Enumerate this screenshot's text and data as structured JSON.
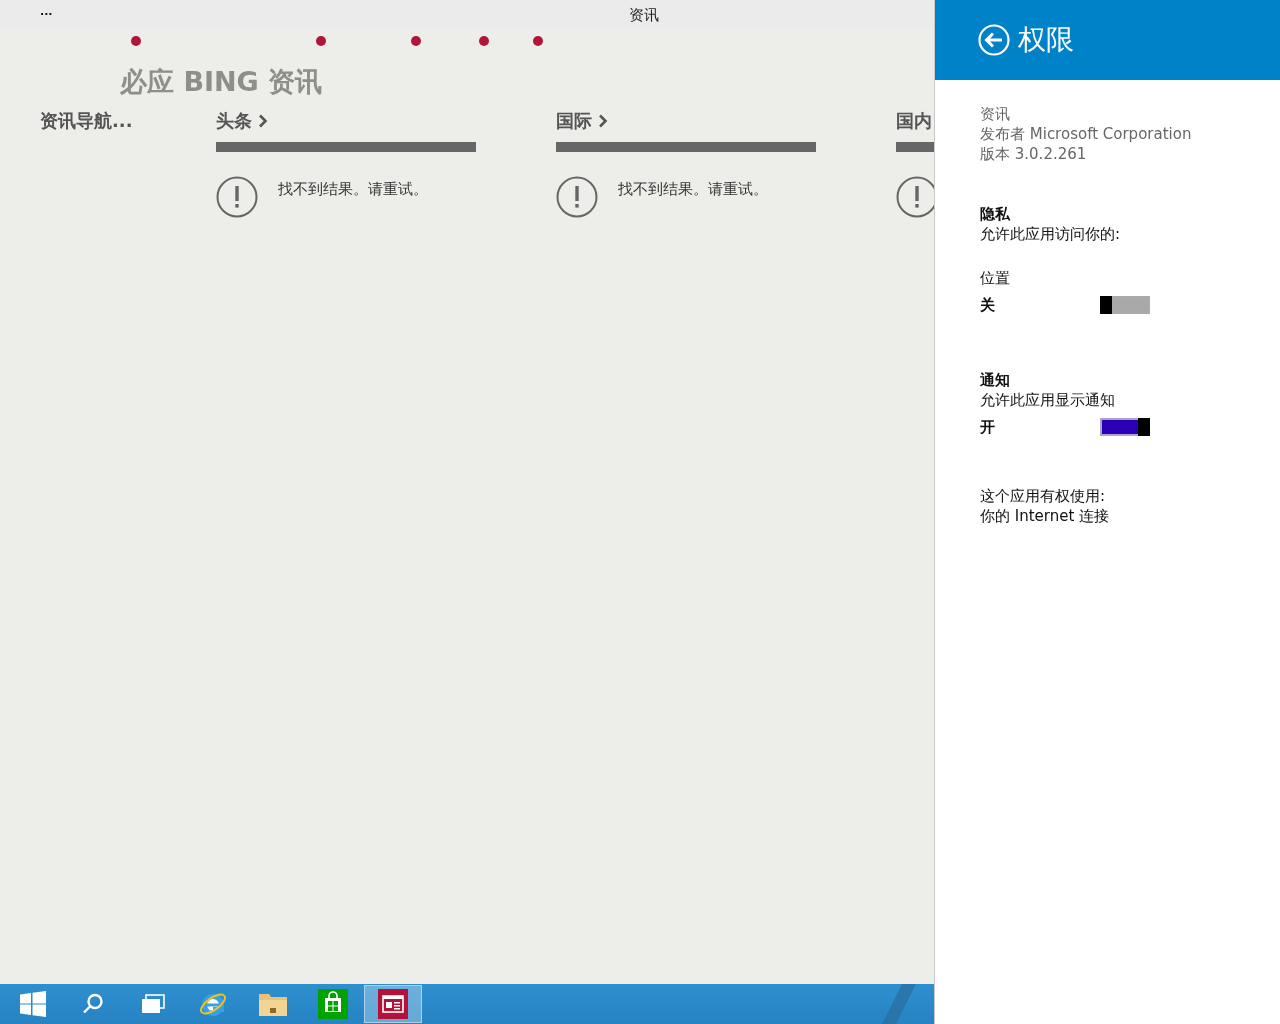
{
  "title_bar": {
    "menu": "...",
    "title": "资讯"
  },
  "app": {
    "brand": "必应 BING 资讯",
    "nav_label": "资讯导航...",
    "sections": [
      {
        "title": "头条",
        "chevron": true,
        "message": "找不到结果。请重试。"
      },
      {
        "title": "国际",
        "chevron": true,
        "message": "找不到结果。请重试。"
      },
      {
        "title": "国内"
      }
    ]
  },
  "taskbar": {
    "items": [
      {
        "kind": "start",
        "selected": false
      },
      {
        "kind": "search",
        "selected": false
      },
      {
        "kind": "task-view",
        "selected": false
      },
      {
        "kind": "browser",
        "selected": false
      },
      {
        "kind": "folder",
        "selected": false
      },
      {
        "kind": "store",
        "selected": false
      },
      {
        "kind": "news",
        "selected": true
      }
    ]
  },
  "settings_pane": {
    "title": "权限",
    "app_info": [
      "资讯",
      "发布者 Microsoft Corporation",
      "版本 3.0.2.261"
    ],
    "privacy": {
      "heading": "隐私",
      "description": "允许此应用访问你的:"
    },
    "toggles": [
      {
        "kind": "sub",
        "label": "位置",
        "state_label": "关",
        "on": false
      },
      {
        "kind": "section",
        "label": "通知",
        "description": "允许此应用显示通知",
        "state_label": "开",
        "on": true
      }
    ],
    "capabilities": {
      "heading": "这个应用有权使用:",
      "items": [
        "你的 Internet 连接"
      ]
    }
  }
}
